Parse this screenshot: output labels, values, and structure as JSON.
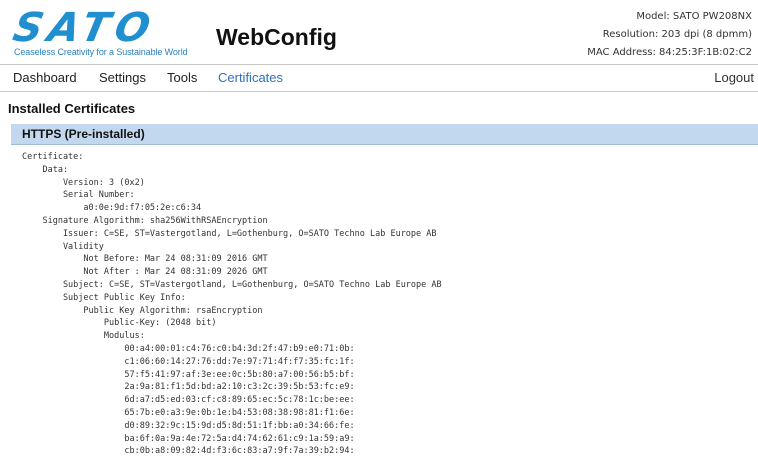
{
  "brand": {
    "logo_text": "SATO",
    "tagline": "Ceaseless Creativity for a Sustainable World",
    "app_title": "WebConfig"
  },
  "device": {
    "model": "Model: SATO PW208NX",
    "resolution": "Resolution: 203 dpi (8 dpmm)",
    "mac": "MAC Address: 84:25:3F:1B:02:C2"
  },
  "nav": {
    "dashboard": "Dashboard",
    "settings": "Settings",
    "tools": "Tools",
    "certificates": "Certificates",
    "logout": "Logout",
    "active": "certificates"
  },
  "page": {
    "section_title": "Installed Certificates",
    "cert_group_title": "HTTPS (Pre-installed)"
  },
  "certificate": {
    "text": "Certificate:\n    Data:\n        Version: 3 (0x2)\n        Serial Number:\n            a0:0e:9d:f7:05:2e:c6:34\n    Signature Algorithm: sha256WithRSAEncryption\n        Issuer: C=SE, ST=Vastergotland, L=Gothenburg, O=SATO Techno Lab Europe AB\n        Validity\n            Not Before: Mar 24 08:31:09 2016 GMT\n            Not After : Mar 24 08:31:09 2026 GMT\n        Subject: C=SE, ST=Vastergotland, L=Gothenburg, O=SATO Techno Lab Europe AB\n        Subject Public Key Info:\n            Public Key Algorithm: rsaEncryption\n                Public-Key: (2048 bit)\n                Modulus:\n                    00:a4:00:01:c4:76:c0:b4:3d:2f:47:b9:e0:71:0b:\n                    c1:06:60:14:27:76:dd:7e:97:71:4f:f7:35:fc:1f:\n                    57:f5:41:97:af:3e:ee:0c:5b:80:a7:00:56:b5:bf:\n                    2a:9a:81:f1:5d:bd:a2:10:c3:2c:39:5b:53:fc:e9:\n                    6d:a7:d5:ed:03:cf:c8:89:65:ec:5c:78:1c:be:ee:\n                    65:7b:e0:a3:9e:0b:1e:b4:53:08:38:98:81:f1:6e:\n                    d0:89:32:9c:15:9d:d5:8d:51:1f:bb:a0:34:66:fe:\n                    ba:6f:0a:9a:4e:72:5a:d4:74:62:61:c9:1a:59:a9:\n                    cb:0b:a8:09:82:4d:f3:6c:83:a7:9f:7a:39:b2:94:"
  },
  "colors": {
    "brand_blue": "#1f8fcf",
    "nav_active": "#2f6fc0",
    "cert_header_bg": "#c2d8ee"
  }
}
